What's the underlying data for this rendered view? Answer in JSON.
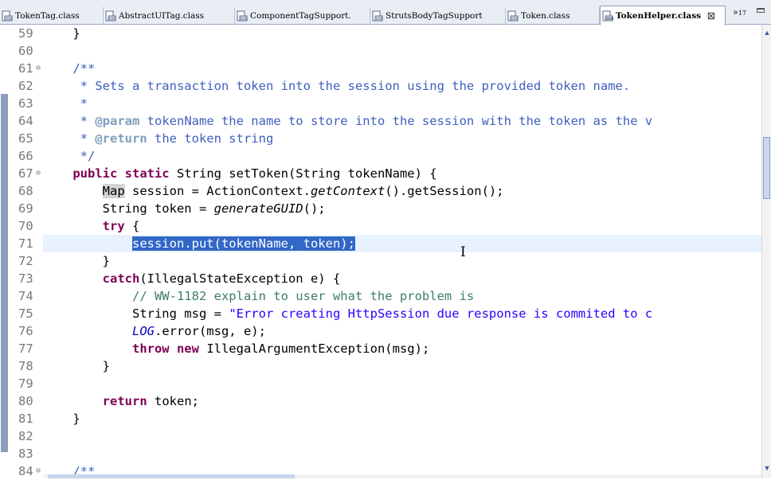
{
  "tabs": [
    {
      "label": "TokenTag.class"
    },
    {
      "label": "AbstractUITag.class"
    },
    {
      "label": "ComponentTagSupport."
    },
    {
      "label": "StrutsBodyTagSupport"
    },
    {
      "label": "Token.class"
    },
    {
      "label": "TokenHelper.class",
      "active": true
    }
  ],
  "close_glyph": "☒",
  "overflow": {
    "symbol": "»",
    "count": "17"
  },
  "line_numbers": [
    "59",
    "60",
    "61",
    "62",
    "63",
    "64",
    "65",
    "66",
    "67",
    "68",
    "69",
    "70",
    "71",
    "72",
    "73",
    "74",
    "75",
    "76",
    "77",
    "78",
    "79",
    "80",
    "81",
    "82",
    "83",
    "84"
  ],
  "fold_glyph": "⊖",
  "code": {
    "l59": "}",
    "l61": "/**",
    "l62": " * Sets a transaction token into the session using the provided token name.",
    "l63": " *",
    "l64_a": " * ",
    "l64_tag": "@param",
    "l64_b": " tokenName the name to store into the session with the token as the v",
    "l65_a": " * ",
    "l65_tag": "@return",
    "l65_b": " the token string",
    "l66": " */",
    "l67_kw": "public static",
    "l67_rest": " String setToken(String tokenName) {",
    "l68_type": "Map",
    "l68_a": " session = ActionContext.",
    "l68_call": "getContext",
    "l68_b": "().getSession();",
    "l69_a": "String token = ",
    "l69_call": "generateGUID",
    "l69_b": "();",
    "l70_kw": "try",
    "l70_b": " {",
    "l71_sel": "session.put(tokenName, token);",
    "l72": "}",
    "l73_kw": "catch",
    "l73_b": "(IllegalStateException e) {",
    "l74": "// WW-1182 explain to user what the problem is",
    "l75_a": "String msg = ",
    "l75_str": "\"Error creating HttpSession due response is commited to c",
    "l76_field": "LOG",
    "l76_b": ".error(msg, e);",
    "l77_kw": "throw new",
    "l77_b": " IllegalArgumentException(msg);",
    "l78": "}",
    "l80_kw": "return",
    "l80_b": " token;",
    "l81": "}",
    "l84": "/**"
  },
  "scroll": {
    "up_arrow": "▲",
    "down_arrow": "▼"
  },
  "text_cursor": "I",
  "colors": {
    "keyword": "#7f0055",
    "javadoc": "#3f5fbf",
    "line_comment": "#3f7f5f",
    "string": "#2a00ff",
    "selection": "#3167c6",
    "current_line": "#e8f2fe"
  }
}
